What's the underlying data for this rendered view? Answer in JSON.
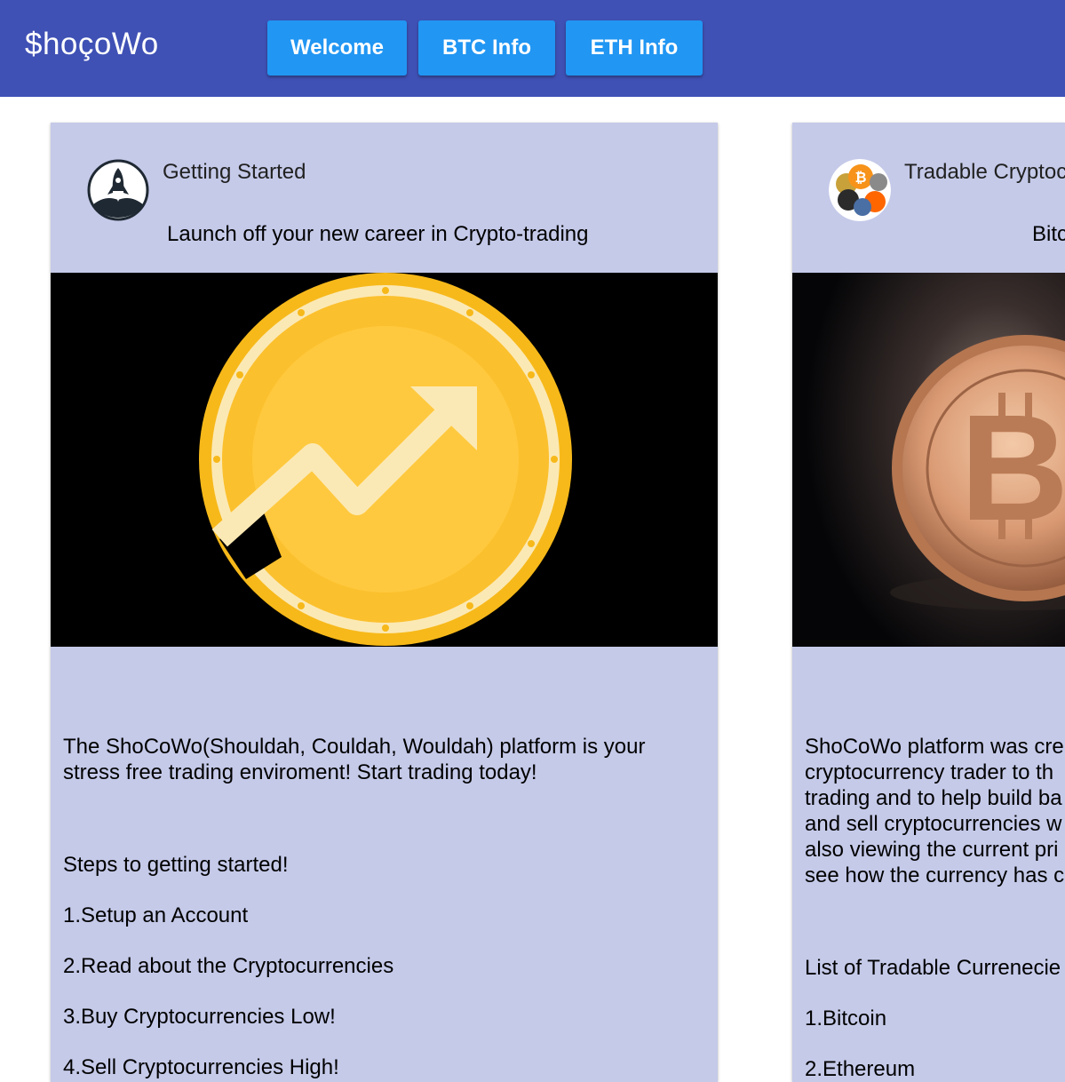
{
  "header": {
    "brand": "$hoçoWo",
    "nav": [
      {
        "label": "Welcome"
      },
      {
        "label": "BTC Info"
      },
      {
        "label": "ETH Info"
      }
    ]
  },
  "colors": {
    "header_bg": "#3f51b5",
    "nav_button_bg": "#2196f3",
    "card_bg": "#c5cae9"
  },
  "cards": [
    {
      "title": "Getting Started",
      "subtitle": "Launch off your new career in Crypto-trading",
      "avatar_icon": "rocket-icon",
      "media_icon": "gold-coin-growth-arrow",
      "description": "The ShoCoWo(Shouldah, Couldah, Wouldah) platform is your stress free trading enviroment! Start trading today!",
      "steps_title": "Steps to getting started!",
      "steps": [
        "1.Setup an Account",
        "2.Read about the Cryptocurrencies",
        "3.Buy Cryptocurrencies Low!",
        "4.Sell Cryptocurrencies High!"
      ]
    },
    {
      "title": "Tradable Cryptoc",
      "subtitle": "Bitc",
      "avatar_icon": "crypto-coins-icon",
      "media_icon": "bitcoin-coin",
      "description_lines": [
        "ShoCoWo platform was cre",
        "cryptocurrency trader to th",
        "trading and to help build ba",
        "and sell cryptocurrencies w",
        "also viewing the current pri",
        "see how the currency has c"
      ],
      "list_title": "List of Tradable Currenecie",
      "items": [
        "1.Bitcoin",
        "2.Ethereum"
      ]
    }
  ]
}
